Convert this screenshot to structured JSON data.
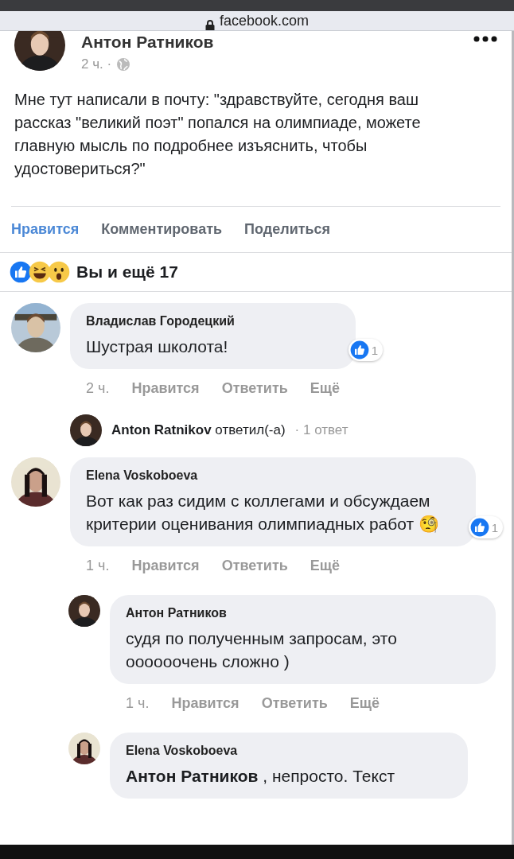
{
  "browser": {
    "url": "facebook.com"
  },
  "post": {
    "author": "Антон Ратников",
    "time": "2 ч. ·",
    "text": "Мне тут написали в почту: \"здравствуйте, сегодня ваш рассказ \"великий поэт\" попался на олимпиаде, можете главную мысль по подробнее изъяснить, чтобы удостовериться?\"",
    "actions": [
      {
        "label": "Нравится",
        "selected": true
      },
      {
        "label": "Комментировать",
        "selected": false
      },
      {
        "label": "Поделиться",
        "selected": false
      }
    ]
  },
  "reactions": {
    "summary": "Вы и ещё 17"
  },
  "comments": [
    {
      "author": "Владислав Городецкий",
      "text": "Шустрая школота!",
      "like_count": "1",
      "time": "2 ч.",
      "actions": [
        {
          "label": "Нравится",
          "selected": false
        },
        {
          "label": "Ответить",
          "selected": false
        },
        {
          "label": "Ещё",
          "selected": false
        }
      ],
      "replies_summary": {
        "text": "**Anton Ratnikov** ответил(-а)",
        "count": "· 1 ответ"
      }
    },
    {
      "author": "Elena Voskoboeva",
      "text": "Вот как раз сидим с коллегами и обсуждаем критерии оценивания олимпиадных работ 🧐",
      "like_count": "1",
      "time": "1 ч.",
      "actions": [
        {
          "label": "Нравится",
          "selected": false
        },
        {
          "label": "Ответить",
          "selected": false
        },
        {
          "label": "Ещё",
          "selected": false
        }
      ],
      "children": [
        {
          "author": "Антон Ратников",
          "text": "судя по полученным запросам, это ooooooчень сложно )",
          "time": "1 ч.",
          "actions": [
            {
              "label": "Нравится",
              "selected": false
            },
            {
              "label": "Ответить",
              "selected": false
            },
            {
              "label": "Ещё",
              "selected": false
            }
          ]
        },
        {
          "author": "Elena Voskoboeva",
          "text": "**Антон Ратников** , непросто. Текст"
        }
      ]
    }
  ]
}
